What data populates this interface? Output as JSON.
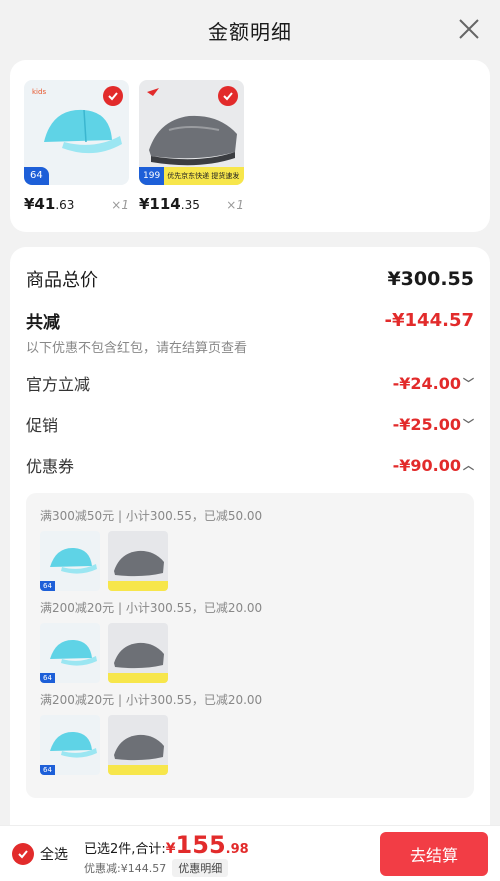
{
  "header": {
    "title": "金额明细"
  },
  "products": [
    {
      "price_main": "¥41",
      "price_dec": ".63",
      "qty": "×1",
      "badge": "64"
    },
    {
      "price_main": "¥114",
      "price_dec": ".35",
      "qty": "×1",
      "badge": "199",
      "strip": "优先京东快递 提货速发"
    }
  ],
  "summary": {
    "total_label": "商品总价",
    "total_value": "¥300.55",
    "reduce_label": "共减",
    "reduce_value": "-¥144.57",
    "note": "以下优惠不包含红包，请在结算页查看",
    "items": [
      {
        "label": "官方立减",
        "value": "-¥24.00"
      },
      {
        "label": "促销",
        "value": "-¥25.00"
      },
      {
        "label": "优惠券",
        "value": "-¥90.00"
      }
    ]
  },
  "coupons": [
    {
      "title": "满300减50元 | 小计300.55，已减50.00"
    },
    {
      "title": "满200减20元 | 小计300.55，已减20.00"
    },
    {
      "title": "满200减20元 | 小计300.55，已减20.00"
    }
  ],
  "footer": {
    "select_all": "全选",
    "selected_text": "已选2件,合计:",
    "yen": "¥",
    "amount_main": "155",
    "amount_dec": ".98",
    "discount": "优惠减:¥144.57",
    "detail_label": "优惠明细",
    "checkout_label": "去结算"
  },
  "colors": {
    "accent": "#e22b2b",
    "checkout": "#f23d45"
  }
}
